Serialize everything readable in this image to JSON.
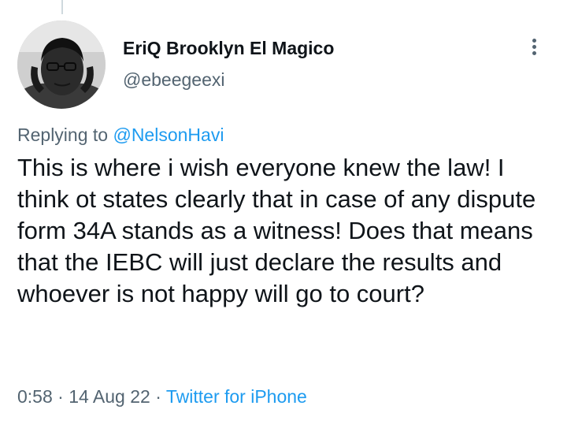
{
  "tweet": {
    "author_name": "EriQ Brooklyn El Magico",
    "author_handle": "@ebeegeexi",
    "replying_prefix": "Replying to",
    "replying_to": "@NelsonHavi",
    "text": "This is where i wish everyone knew the law! I think ot states clearly that in case of any dispute form 34A stands as a witness! Does that means that the IEBC will just declare the results and whoever is not happy will go to court?",
    "time": "0:58",
    "separator": "·",
    "date": "14 Aug 22",
    "source": "Twitter for iPhone"
  },
  "icons": {
    "more": "more-vertical-icon",
    "avatar": "avatar-image"
  },
  "colors": {
    "text": "#0f1419",
    "secondary": "#536471",
    "link": "#1d9bf0",
    "background": "#ffffff"
  }
}
